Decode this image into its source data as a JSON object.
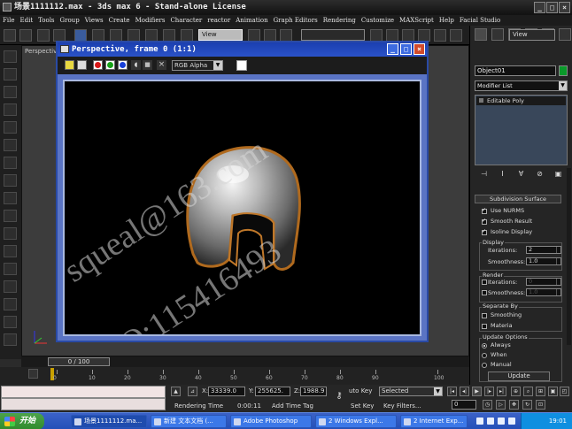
{
  "window": {
    "title": "场景1111112.max - 3ds max 6 - Stand-alone License"
  },
  "menu": [
    "File",
    "Edit",
    "Tools",
    "Group",
    "Views",
    "Create",
    "Modifiers",
    "Character",
    "reactor",
    "Animation",
    "Graph Editors",
    "Rendering",
    "Customize",
    "MAXScript",
    "Help",
    "Facial Studio"
  ],
  "toolbar": {
    "view_select": "View",
    "view_select2": "View"
  },
  "viewport": {
    "label": "Perspective"
  },
  "render_frame": {
    "title": "Perspective, frame 0 (1:1)",
    "channel": "RGB Alpha",
    "dot_colors": [
      "#d81818",
      "#17a217",
      "#1740d8"
    ],
    "watermark_1": "squeal@163.com",
    "watermark_2": "QQ:115416493"
  },
  "command_panel": {
    "object_name": "Object01",
    "object_color": "#0a9a2a",
    "modifier_list": "Modifier List",
    "stack_item": "Editable Poly",
    "subdivision_header": "Subdivision Surface",
    "use_nurms": "Use NURMS",
    "smooth_result": "Smooth Result",
    "isoline_display": "Isoline Display",
    "display_label": "Display",
    "iterations_label": "Iterations:",
    "iterations_value": "2",
    "smoothness_label": "Smoothness:",
    "smoothness_value": "1.0",
    "render_label": "Render",
    "render_iterations_label": "Iterations:",
    "render_iterations_value": "0",
    "render_smoothness_label": "Smoothness:",
    "render_smoothness_value": "1.0",
    "separate_by": "Separate By",
    "smoothing": "Smoothing",
    "materia": "Materia",
    "update_options": "Update Options",
    "always": "Always",
    "when": "When",
    "manual": "Manual",
    "update_button": "Update"
  },
  "timeline": {
    "frame_display": "0 / 100",
    "ticks": [
      "0",
      "10",
      "20",
      "30",
      "40",
      "50",
      "60",
      "70",
      "80",
      "90",
      "100"
    ]
  },
  "status": {
    "x_label": "X:",
    "x_value": "33339.0",
    "y_label": "Y:",
    "y_value": "255625.",
    "z_label": "Z:",
    "z_value": "1988.9",
    "auto_key": "uto Key",
    "selected": "Selected",
    "set_key": "Set Key",
    "key_filters": "Key Filters...",
    "rendering_time_label": "Rendering Time",
    "rendering_time_value": "0:00:11",
    "add_time_tag": "Add Time Tag",
    "frame_field": "0"
  },
  "taskbar": {
    "start": "开始",
    "tasks": [
      "场景1111112.ma...",
      "新建 文本文档 (...",
      "Adobe Photoshop",
      "2 Windows Expl...",
      "2 Internet Exp..."
    ],
    "clock": "19:01"
  }
}
